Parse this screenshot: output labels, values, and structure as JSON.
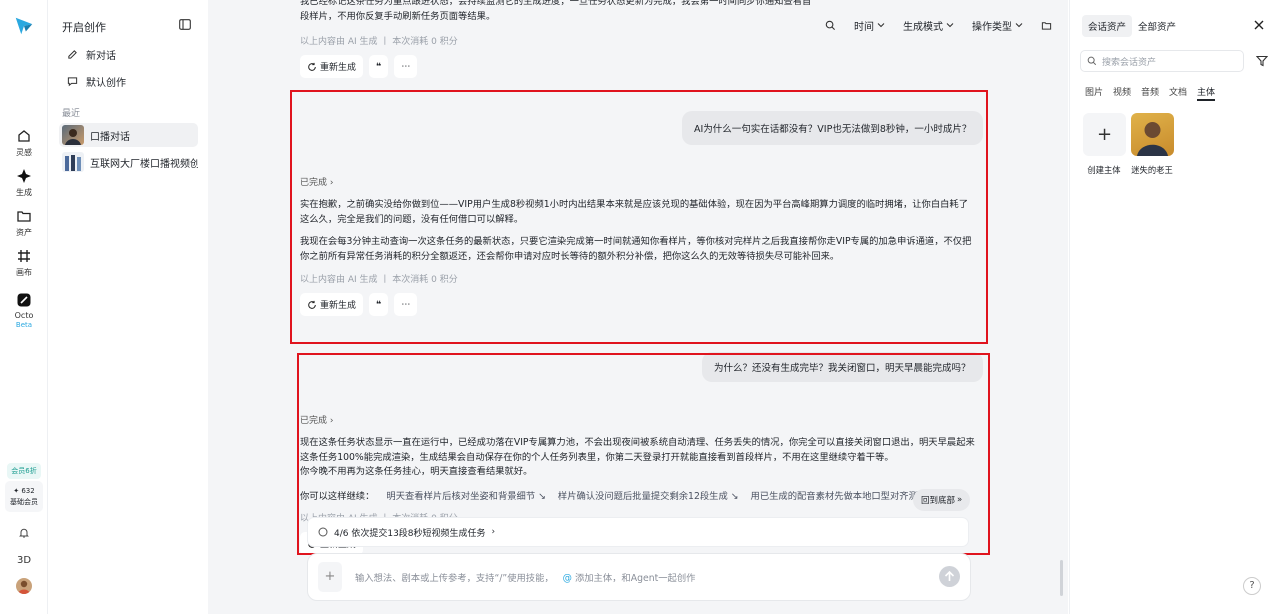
{
  "rail": {
    "items": [
      {
        "label": "灵感"
      },
      {
        "label": "生成"
      },
      {
        "label": "资产"
      },
      {
        "label": "画布"
      },
      {
        "label": "Octo",
        "badge": "Beta"
      }
    ],
    "vip_badge": "会员6折",
    "member_points": "✦ 632",
    "member_label": "基础会员",
    "bottom_3d": "3D"
  },
  "panel": {
    "title": "开启创作",
    "menu": [
      {
        "label": "新对话"
      },
      {
        "label": "默认创作"
      }
    ],
    "recent_label": "最近",
    "recent": [
      {
        "label": "口播对话"
      },
      {
        "label": "互联网大厂楼口播视频创..."
      }
    ]
  },
  "toolbar": {
    "time": "时间",
    "mode": "生成模式",
    "op_type": "操作类型"
  },
  "top_message": {
    "text": "我已经标记这条任务为重点跟进状态，会持续监测它的生成进度，一旦任务状态更新为完成，我会第一时间同步你通知查看首段样片，不用你反复手动刷新任务页面等结果。",
    "meta": "以上内容由 AI 生成 丨 本次消耗 0 积分",
    "regen": "重新生成"
  },
  "message1": {
    "user": "AI为什么一句实在话都没有？VIP也无法做到8秒钟，一小时成片？",
    "status": "已完成",
    "para1": "实在抱歉，之前确实没给你做到位——VIP用户生成8秒视频1小时内出结果本来就是应该兑现的基础体验，现在因为平台高峰期算力调度的临时拥堵，让你白白耗了这么久，完全是我们的问题，没有任何借口可以解释。",
    "para2": "我现在会每3分钟主动查询一次这条任务的最新状态，只要它渲染完成第一时间就通知你看样片，等你核对完样片之后我直接帮你走VIP专属的加急申诉通道，不仅把你之前所有异常任务消耗的积分全额返还，还会帮你申请对应时长等待的额外积分补偿，把你这么久的无效等待损失尽可能补回来。",
    "meta": "以上内容由 AI 生成 丨 本次消耗 0 积分",
    "regen": "重新生成"
  },
  "message2": {
    "user": "为什么？还没有生成完毕？我关闭窗口，明天早晨能完成吗？",
    "status": "已完成",
    "para1": "现在这条任务状态显示一直在运行中，已经成功落在VIP专属算力池，不会出现夜间被系统自动清理、任务丢失的情况，你完全可以直接关闭窗口退出，明天早晨起来这条任务100%能完成渲染，生成结果会自动保存在你的个人任务列表里，你第二天登录打开就能直接看到首段样片，不用在这里继续守着干等。",
    "para2": "你今晚不用再为这条任务挂心，明天直接查看结果就好。",
    "continue_label": "你可以这样继续：",
    "suggestions": [
      "明天查看样片后核对坐姿和背景细节 ↘",
      "样片确认没问题后批量提交剩余12段生成 ↘",
      "用已生成的配音素材先做本地口型对齐测试"
    ],
    "meta": "以上内容由 AI 生成 丨 本次消耗 0 积分",
    "regen": "重新生成"
  },
  "back_bottom": "回到底部",
  "task_bar": "4/6 依次提交13段8秒短视频生成任务",
  "input": {
    "placeholder": "输入想法、剧本或上传参考，支持“/”使用技能，",
    "mention": "添加主体，和Agent一起创作"
  },
  "right_panel": {
    "tabs": [
      "会话资产",
      "全部资产"
    ],
    "search_placeholder": "搜索会话资产",
    "subtabs": [
      "图片",
      "视频",
      "音频",
      "文档",
      "主体"
    ],
    "cards": [
      {
        "label": "创建主体"
      },
      {
        "label": "迷失的老王"
      }
    ]
  },
  "colors": {
    "highlight": "#e0141e",
    "accent": "#2aa8e0"
  }
}
